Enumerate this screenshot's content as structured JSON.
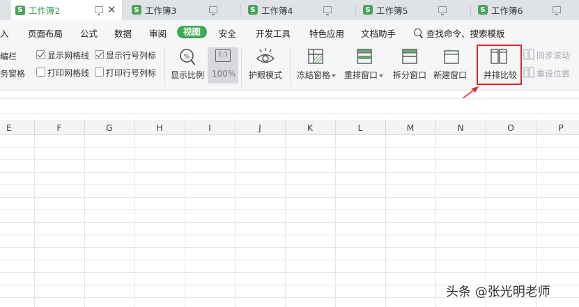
{
  "tabs": [
    {
      "name": "工作簿2",
      "badge": "S",
      "active": true
    },
    {
      "name": "工作簿3",
      "badge": "S"
    },
    {
      "name": "工作簿4",
      "badge": "S"
    },
    {
      "name": "工作簿5",
      "badge": "S"
    },
    {
      "name": "工作簿6",
      "badge": "S"
    }
  ],
  "menu": {
    "items": [
      "插入",
      "页面布局",
      "公式",
      "数据",
      "审阅",
      "视图",
      "安全",
      "开发工具",
      "特色应用",
      "文档助手"
    ],
    "visible_first": "入",
    "active": "视图",
    "search": "查找命令、搜索模板"
  },
  "ribbon": {
    "edit_bar_partial": "编栏",
    "task_pane_partial": "务窗格",
    "show_gridlines": "显示网格线",
    "show_headers": "显示行号列标",
    "print_gridlines": "打印网格线",
    "print_headers": "打印行号列标",
    "zoom": "显示比例",
    "zoom_100": "100%",
    "ratio_icon": "1:1",
    "eye_mode": "护眼模式",
    "freeze": "冻结窗格",
    "arrange": "重排窗口",
    "split": "拆分窗口",
    "new_window": "新建窗口",
    "side_by_side": "并排比较",
    "sync_scroll": "同步滚动",
    "reset_position": "重设位置"
  },
  "grid": {
    "columns": [
      "E",
      "F",
      "G",
      "H",
      "I",
      "J",
      "K",
      "L",
      "M",
      "N",
      "O",
      "P"
    ]
  },
  "watermark": "头条 @张光明老师",
  "colors": {
    "accent": "#3daa52",
    "highlight_box": "#e0242b",
    "tab_bar": "#dfe2e7",
    "ribbon_bg": "#f5f6f7"
  }
}
